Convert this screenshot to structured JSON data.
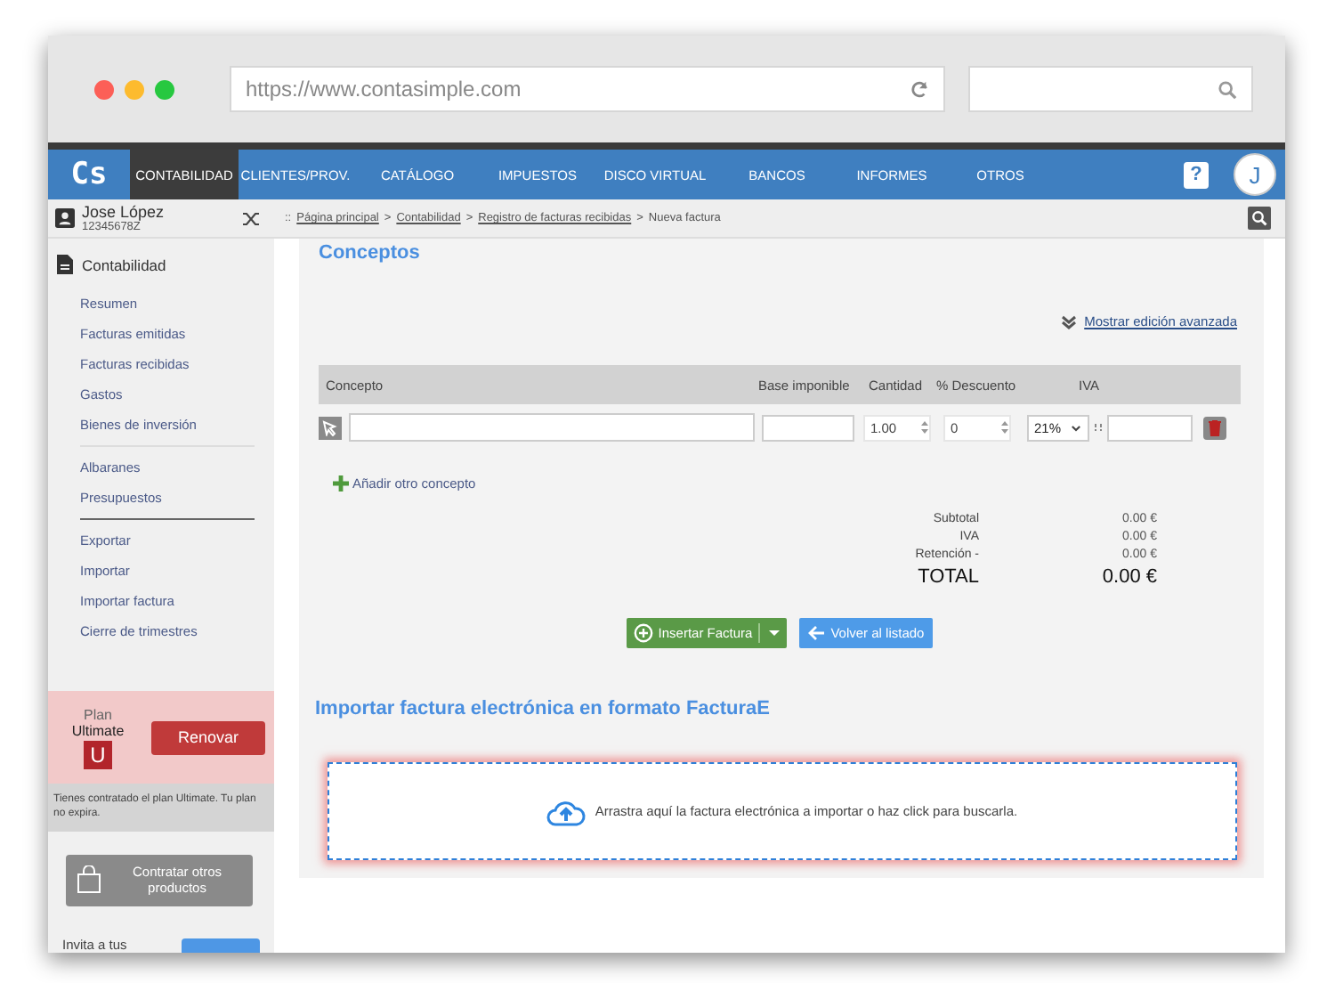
{
  "browser": {
    "url": "https://www.contasimple.com"
  },
  "nav": {
    "logo": "Cs",
    "items": [
      {
        "label": "CONTABILIDAD",
        "selected": true
      },
      {
        "label": "CLIENTES/PROV.",
        "selected": false
      },
      {
        "label": "CATÁLOGO",
        "selected": false
      },
      {
        "label": "IMPUESTOS",
        "selected": false
      },
      {
        "label": "DISCO VIRTUAL",
        "selected": false
      },
      {
        "label": "BANCOS",
        "selected": false
      },
      {
        "label": "INFORMES",
        "selected": false
      },
      {
        "label": "OTROS",
        "selected": false
      }
    ],
    "help": "?",
    "avatar": "J"
  },
  "user": {
    "name": "Jose López",
    "id": "12345678Z"
  },
  "breadcrumb": {
    "prefix": "::",
    "links": [
      "Página principal",
      "Contabilidad",
      "Registro de facturas recibidas"
    ],
    "separator": ">",
    "current": "Nueva factura"
  },
  "sidebar": {
    "section": "Contabilidad",
    "groups": [
      [
        "Resumen",
        "Facturas emitidas",
        "Facturas recibidas",
        "Gastos",
        "Bienes de inversión"
      ],
      [
        "Albaranes",
        "Presupuestos"
      ],
      [
        "Exportar",
        "Importar",
        "Importar factura",
        "Cierre de trimestres"
      ]
    ]
  },
  "plan": {
    "label": "Plan",
    "name": "Ultimate",
    "badge": "U",
    "button": "Renovar",
    "note": "Tienes contratado el plan Ultimate. Tu plan no expira.",
    "other_button": "Contratar otros productos",
    "invite": "Invita a tus"
  },
  "conceptos": {
    "title": "Conceptos",
    "advanced_link": "Mostrar edición avanzada",
    "columns": [
      "Concepto",
      "Base imponible",
      "Cantidad",
      "% Descuento",
      "IVA"
    ],
    "row": {
      "quantity": "1.00",
      "discount": "0",
      "iva": "21%"
    },
    "add_link": "Añadir otro concepto",
    "totals": [
      {
        "kind": "line",
        "label": "Subtotal",
        "value": "0.00 €"
      },
      {
        "kind": "line",
        "label": "IVA",
        "value": "0.00 €"
      },
      {
        "kind": "line",
        "label": "Retención -",
        "value": "0.00 €"
      },
      {
        "kind": "total",
        "label": "TOTAL",
        "value": "0.00 €"
      }
    ],
    "insert_button": "Insertar Factura",
    "back_button": "Volver al listado"
  },
  "import": {
    "title": "Importar factura electrónica en formato FacturaE",
    "dropzone": "Arrastra aquí la factura electrónica a importar o haz click para buscarla."
  }
}
